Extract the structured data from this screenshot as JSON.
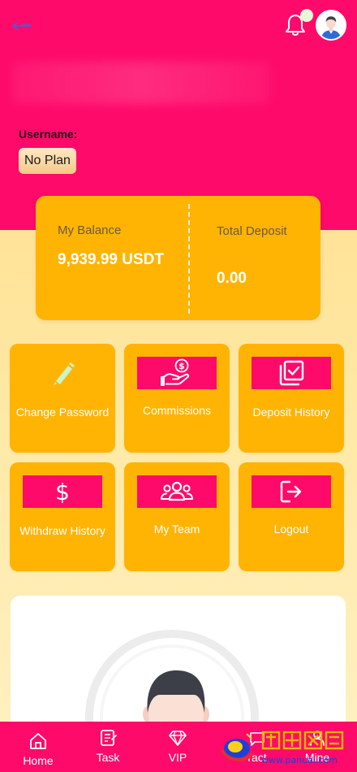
{
  "header": {
    "username_label": "Username:",
    "plan": "No Plan"
  },
  "balance": {
    "my_balance_label": "My Balance",
    "my_balance_value": "9,939.99 USDT",
    "total_deposit_label": "Total Deposit",
    "total_deposit_value": "0.00"
  },
  "tiles": {
    "change_password": "Change Password",
    "commissions": "Commissions",
    "deposit_history": "Deposit History",
    "withdraw_history": "Withdraw History",
    "my_team": "My Team",
    "logout": "Logout"
  },
  "nav": {
    "home": "Home",
    "task": "Task",
    "vip": "VIP",
    "contact": "ract",
    "mine": "Mine"
  },
  "watermark": {
    "text": "www.panuai.com"
  },
  "colors": {
    "primary_pink": "#fe0a6a",
    "card_orange": "#ffb404",
    "background_yellow": "#ffe9a6",
    "accent_mint": "#c9f5c8"
  },
  "icons": {
    "back": "back-arrow-icon",
    "bell": "bell-icon",
    "pencil": "pencil-icon",
    "commissions": "hand-coin-icon",
    "deposit_history": "checklist-icon",
    "withdraw": "dollar-icon",
    "team": "team-icon",
    "logout": "logout-icon"
  }
}
